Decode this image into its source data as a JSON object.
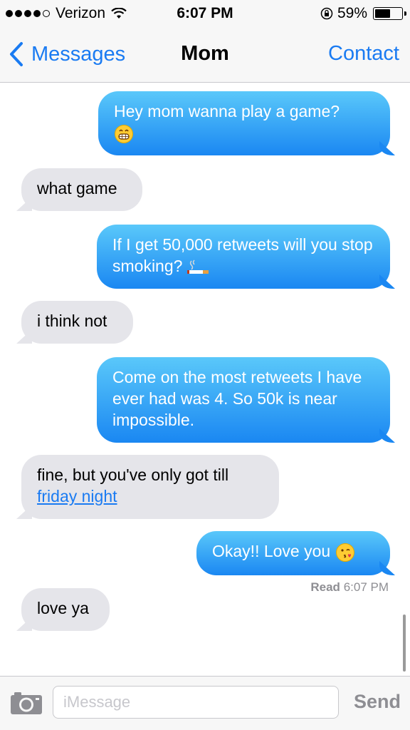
{
  "status_bar": {
    "carrier": "Verizon",
    "time": "6:07 PM",
    "battery": "59%",
    "battery_level": 0.59,
    "signal_bars": 4,
    "signal_total": 5
  },
  "nav": {
    "back_label": "Messages",
    "title": "Mom",
    "right_label": "Contact"
  },
  "messages": [
    {
      "from": "me",
      "text": "Hey mom wanna play a game?",
      "emoji": "grinning-face-icon"
    },
    {
      "from": "mom",
      "text": "what game"
    },
    {
      "from": "me",
      "text": "If I get 50,000 retweets will you stop smoking?",
      "emoji": "cigarette-icon"
    },
    {
      "from": "mom",
      "text": "i think not"
    },
    {
      "from": "me",
      "text": "Come on the most retweets I have ever had was 4. So 50k is near impossible."
    },
    {
      "from": "mom",
      "text": "fine, but you've only got till",
      "link": "friday night"
    },
    {
      "from": "me",
      "text": "Okay!! Love you",
      "emoji": "kissing-face-icon"
    },
    {
      "from": "mom",
      "text": "love ya"
    }
  ],
  "read_receipt": {
    "label": "Read",
    "time": "6:07 PM"
  },
  "composer": {
    "placeholder": "iMessage",
    "send_label": "Send"
  },
  "colors": {
    "accent": "#1a7bf2",
    "bubble_out_top": "#5ac8fa",
    "bubble_out_bottom": "#1a87f2",
    "bubble_in": "#e5e5ea"
  }
}
